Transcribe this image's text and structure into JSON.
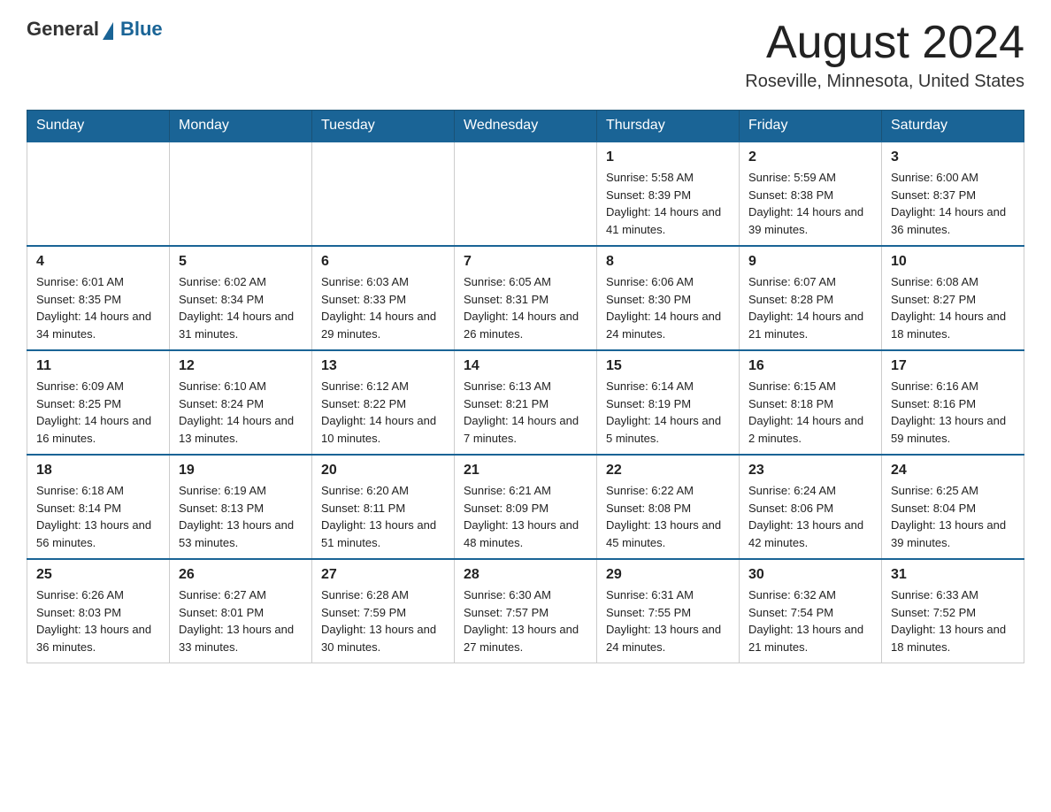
{
  "header": {
    "logo_general": "General",
    "logo_blue": "Blue",
    "month_title": "August 2024",
    "location": "Roseville, Minnesota, United States"
  },
  "days_of_week": [
    "Sunday",
    "Monday",
    "Tuesday",
    "Wednesday",
    "Thursday",
    "Friday",
    "Saturday"
  ],
  "weeks": [
    {
      "days": [
        {
          "number": "",
          "info": ""
        },
        {
          "number": "",
          "info": ""
        },
        {
          "number": "",
          "info": ""
        },
        {
          "number": "",
          "info": ""
        },
        {
          "number": "1",
          "info": "Sunrise: 5:58 AM\nSunset: 8:39 PM\nDaylight: 14 hours and 41 minutes."
        },
        {
          "number": "2",
          "info": "Sunrise: 5:59 AM\nSunset: 8:38 PM\nDaylight: 14 hours and 39 minutes."
        },
        {
          "number": "3",
          "info": "Sunrise: 6:00 AM\nSunset: 8:37 PM\nDaylight: 14 hours and 36 minutes."
        }
      ]
    },
    {
      "days": [
        {
          "number": "4",
          "info": "Sunrise: 6:01 AM\nSunset: 8:35 PM\nDaylight: 14 hours and 34 minutes."
        },
        {
          "number": "5",
          "info": "Sunrise: 6:02 AM\nSunset: 8:34 PM\nDaylight: 14 hours and 31 minutes."
        },
        {
          "number": "6",
          "info": "Sunrise: 6:03 AM\nSunset: 8:33 PM\nDaylight: 14 hours and 29 minutes."
        },
        {
          "number": "7",
          "info": "Sunrise: 6:05 AM\nSunset: 8:31 PM\nDaylight: 14 hours and 26 minutes."
        },
        {
          "number": "8",
          "info": "Sunrise: 6:06 AM\nSunset: 8:30 PM\nDaylight: 14 hours and 24 minutes."
        },
        {
          "number": "9",
          "info": "Sunrise: 6:07 AM\nSunset: 8:28 PM\nDaylight: 14 hours and 21 minutes."
        },
        {
          "number": "10",
          "info": "Sunrise: 6:08 AM\nSunset: 8:27 PM\nDaylight: 14 hours and 18 minutes."
        }
      ]
    },
    {
      "days": [
        {
          "number": "11",
          "info": "Sunrise: 6:09 AM\nSunset: 8:25 PM\nDaylight: 14 hours and 16 minutes."
        },
        {
          "number": "12",
          "info": "Sunrise: 6:10 AM\nSunset: 8:24 PM\nDaylight: 14 hours and 13 minutes."
        },
        {
          "number": "13",
          "info": "Sunrise: 6:12 AM\nSunset: 8:22 PM\nDaylight: 14 hours and 10 minutes."
        },
        {
          "number": "14",
          "info": "Sunrise: 6:13 AM\nSunset: 8:21 PM\nDaylight: 14 hours and 7 minutes."
        },
        {
          "number": "15",
          "info": "Sunrise: 6:14 AM\nSunset: 8:19 PM\nDaylight: 14 hours and 5 minutes."
        },
        {
          "number": "16",
          "info": "Sunrise: 6:15 AM\nSunset: 8:18 PM\nDaylight: 14 hours and 2 minutes."
        },
        {
          "number": "17",
          "info": "Sunrise: 6:16 AM\nSunset: 8:16 PM\nDaylight: 13 hours and 59 minutes."
        }
      ]
    },
    {
      "days": [
        {
          "number": "18",
          "info": "Sunrise: 6:18 AM\nSunset: 8:14 PM\nDaylight: 13 hours and 56 minutes."
        },
        {
          "number": "19",
          "info": "Sunrise: 6:19 AM\nSunset: 8:13 PM\nDaylight: 13 hours and 53 minutes."
        },
        {
          "number": "20",
          "info": "Sunrise: 6:20 AM\nSunset: 8:11 PM\nDaylight: 13 hours and 51 minutes."
        },
        {
          "number": "21",
          "info": "Sunrise: 6:21 AM\nSunset: 8:09 PM\nDaylight: 13 hours and 48 minutes."
        },
        {
          "number": "22",
          "info": "Sunrise: 6:22 AM\nSunset: 8:08 PM\nDaylight: 13 hours and 45 minutes."
        },
        {
          "number": "23",
          "info": "Sunrise: 6:24 AM\nSunset: 8:06 PM\nDaylight: 13 hours and 42 minutes."
        },
        {
          "number": "24",
          "info": "Sunrise: 6:25 AM\nSunset: 8:04 PM\nDaylight: 13 hours and 39 minutes."
        }
      ]
    },
    {
      "days": [
        {
          "number": "25",
          "info": "Sunrise: 6:26 AM\nSunset: 8:03 PM\nDaylight: 13 hours and 36 minutes."
        },
        {
          "number": "26",
          "info": "Sunrise: 6:27 AM\nSunset: 8:01 PM\nDaylight: 13 hours and 33 minutes."
        },
        {
          "number": "27",
          "info": "Sunrise: 6:28 AM\nSunset: 7:59 PM\nDaylight: 13 hours and 30 minutes."
        },
        {
          "number": "28",
          "info": "Sunrise: 6:30 AM\nSunset: 7:57 PM\nDaylight: 13 hours and 27 minutes."
        },
        {
          "number": "29",
          "info": "Sunrise: 6:31 AM\nSunset: 7:55 PM\nDaylight: 13 hours and 24 minutes."
        },
        {
          "number": "30",
          "info": "Sunrise: 6:32 AM\nSunset: 7:54 PM\nDaylight: 13 hours and 21 minutes."
        },
        {
          "number": "31",
          "info": "Sunrise: 6:33 AM\nSunset: 7:52 PM\nDaylight: 13 hours and 18 minutes."
        }
      ]
    }
  ]
}
